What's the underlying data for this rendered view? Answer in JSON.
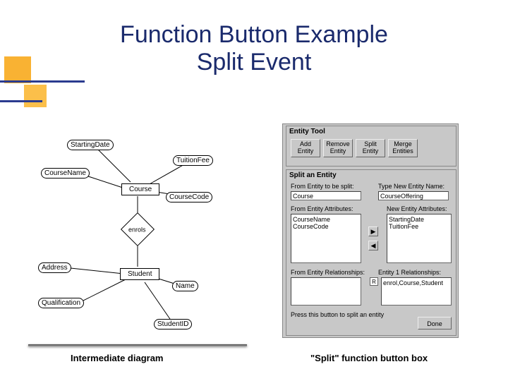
{
  "title_line1": "Function Button Example",
  "title_line2": "Split Event",
  "diagram": {
    "attrs": {
      "startingDate": "StartingDate",
      "tuitionFee": "TuitionFee",
      "courseName": "CourseName",
      "courseCode": "CourseCode",
      "address": "Address",
      "qualification": "Qualification",
      "name": "Name",
      "studentId": "StudentID"
    },
    "entities": {
      "course": "Course",
      "student": "Student"
    },
    "rel": "enrols"
  },
  "captions": {
    "left": "Intermediate diagram",
    "right": "\"Split\" function button box"
  },
  "dialog": {
    "entityToolTitle": "Entity Tool",
    "buttons": {
      "addEntity": "Add\nEntity",
      "removeEntity": "Remove\nEntity",
      "splitEntity": "Split\nEntity",
      "mergeEntities": "Merge\nEntities",
      "done": "Done"
    },
    "splitTitle": "Split an Entity",
    "labels": {
      "fromEntity": "From Entity to be split:",
      "newEntityName": "Type New Entity Name:",
      "fromAttrs": "From Entity Attributes:",
      "newAttrs": "New Entity Attributes:",
      "fromRels": "From Entity Relationships:",
      "newRels": "Entity 1 Relationships:",
      "hint": "Press this button to split an entity"
    },
    "values": {
      "fromEntity": "Course",
      "newEntityName": "CourseOffering",
      "fromAttrs": [
        "CourseName",
        "CourseCode"
      ],
      "newAttrs": [
        "StartingDate",
        "TuitionFee"
      ],
      "fromRels": [],
      "newRels": [
        "enrol,Course,Student"
      ]
    },
    "checkbox": "R"
  }
}
